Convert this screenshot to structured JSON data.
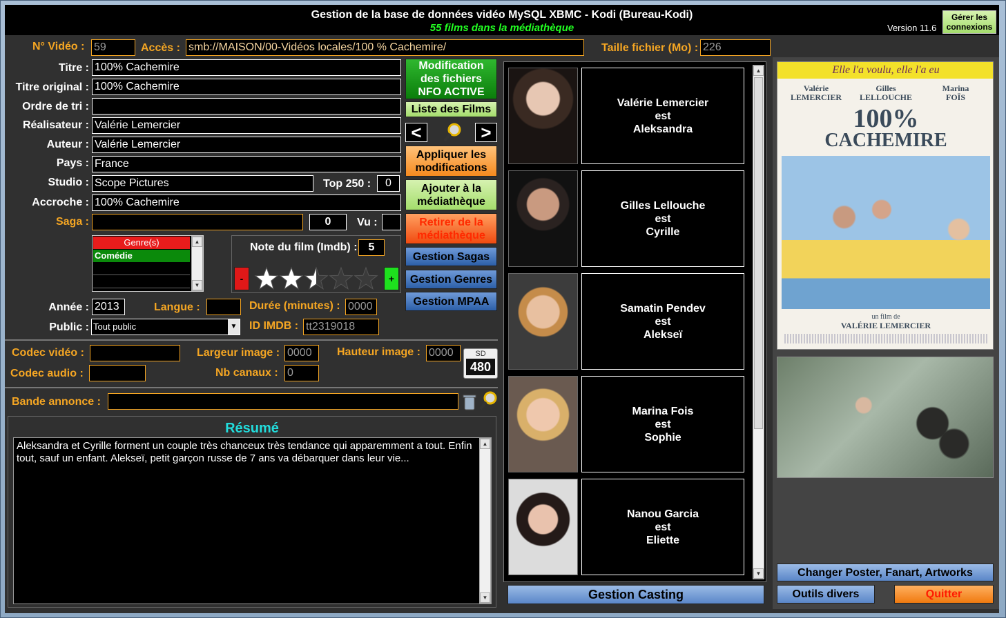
{
  "window": {
    "title": "Gestion de la base de données vidéo MySQL XBMC - Kodi (Bureau-Kodi)",
    "subtitle": "55 films dans la médiathèque",
    "version": "Version 11.6",
    "connections_button": "Gérer les connexions"
  },
  "form": {
    "no_video": {
      "label": "N° Vidéo :",
      "value": "59"
    },
    "acces": {
      "label": "Accès :",
      "value": "smb://MAISON/00-Vidéos locales/100 % Cachemire/"
    },
    "taille": {
      "label": "Taille fichier (Mo) :",
      "value": "226"
    },
    "titre": {
      "label": "Titre :",
      "value": "100% Cachemire"
    },
    "titre_original": {
      "label": "Titre original :",
      "value": "100% Cachemire"
    },
    "ordre": {
      "label": "Ordre de tri :",
      "value": ""
    },
    "realisateur": {
      "label": "Réalisateur :",
      "value": "Valérie Lemercier"
    },
    "auteur": {
      "label": "Auteur :",
      "value": "Valérie Lemercier"
    },
    "pays": {
      "label": "Pays :",
      "value": "France"
    },
    "studio": {
      "label": "Studio :",
      "value": "Scope Pictures"
    },
    "top250": {
      "label": "Top 250 :",
      "value": "0"
    },
    "accroche": {
      "label": "Accroche :",
      "value": "100% Cachemire"
    },
    "saga": {
      "label": "Saga :",
      "value": "",
      "count": "0"
    },
    "vu": {
      "label": "Vu :",
      "value": ""
    },
    "genres": {
      "header": "Genre(s)",
      "items": [
        "Comédie",
        "",
        ""
      ]
    },
    "note": {
      "label": "Note du film (Imdb) :",
      "value": "5",
      "stars": 2.5,
      "max_stars": 5,
      "minus": "-",
      "plus": "+"
    },
    "annee": {
      "label": "Année :",
      "value": "2013"
    },
    "langue": {
      "label": "Langue :",
      "value": ""
    },
    "duree": {
      "label": "Durée (minutes) :",
      "value": "0000"
    },
    "public": {
      "label": "Public :",
      "value": "Tout public"
    },
    "imdb": {
      "label": "ID IMDB :",
      "value": "tt2319018"
    },
    "codec_video": {
      "label": "Codec vidéo :",
      "value": ""
    },
    "codec_audio": {
      "label": "Codec audio :",
      "value": ""
    },
    "largeur": {
      "label": "Largeur image :",
      "value": "0000"
    },
    "hauteur": {
      "label": "Hauteur image :",
      "value": "0000"
    },
    "canaux": {
      "label": "Nb canaux :",
      "value": "0"
    },
    "resolution_badge": {
      "top": "SD",
      "bottom": "480"
    },
    "bande_annonce": {
      "label": "Bande annonce :",
      "value": ""
    },
    "resume": {
      "title": "Résumé",
      "text": "Aleksandra et Cyrille forment un couple très chanceux très tendance qui apparemment a tout. Enfin tout, sauf un enfant. Alekseï, petit garçon russe de 7 ans va débarquer dans leur vie..."
    }
  },
  "buttons": {
    "nfo": "Modification des fichiers NFO ACTIVE",
    "liste": "Liste des Films",
    "prev": "<",
    "next": ">",
    "appliquer": "Appliquer les modifications",
    "ajouter": "Ajouter à la médiathèque",
    "retirer": "Retirer de la médiathèque",
    "sagas": "Gestion Sagas",
    "genres": "Gestion Genres",
    "mpaa": "Gestion MPAA",
    "casting": "Gestion Casting",
    "poster": "Changer Poster, Fanart, Artworks",
    "outils": "Outils divers",
    "quitter": "Quitter"
  },
  "cast": [
    {
      "actor": "Valérie Lemercier",
      "est": "est",
      "role": "Aleksandra"
    },
    {
      "actor": "Gilles Lellouche",
      "est": "est",
      "role": "Cyrille"
    },
    {
      "actor": "Samatin Pendev",
      "est": "est",
      "role": "Alekseï"
    },
    {
      "actor": "Marina Fois",
      "est": "est",
      "role": "Sophie"
    },
    {
      "actor": "Nanou Garcia",
      "est": "est",
      "role": "Eliette"
    }
  ],
  "poster": {
    "tagline": "Elle l'a voulu, elle l'a eu",
    "actors": [
      "Valérie\nLEMERCIER",
      "Gilles\nLELLOUCHE",
      "Marina\nFOÏS"
    ],
    "title1": "100%",
    "title2": "CACHEMIRE",
    "film_by": "un film de",
    "director": "VALÉRIE LEMERCIER"
  },
  "colors": {
    "accent_orange": "#f5a623",
    "subtitle_green": "#22ff22",
    "resume_title": "#22dcdc"
  }
}
